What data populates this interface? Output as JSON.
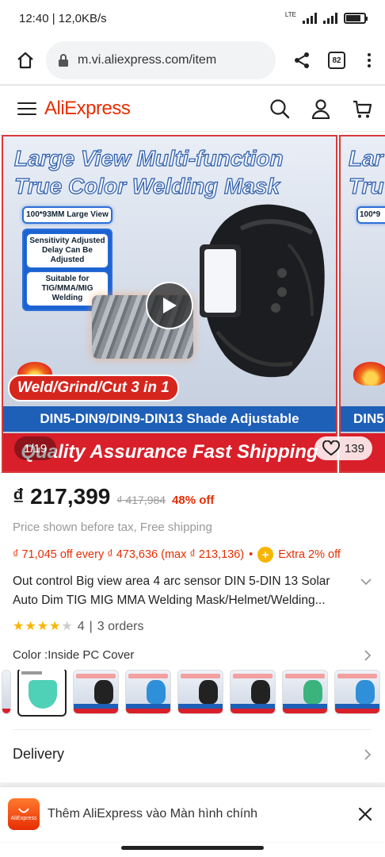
{
  "status_bar": {
    "time_speed": "12:40 | 12,0KB/s",
    "network": "LTE"
  },
  "browser": {
    "url": "m.vi.aliexpress.com/item",
    "tabs_count": "82"
  },
  "site": {
    "logo": "AliExpress"
  },
  "gallery": {
    "headline_line1": "Large View Multi-function",
    "headline_line2": "True Color Welding Mask",
    "feature_1": "100*93MM Large View",
    "feature_2": "Sensitivity Adjusted Delay Can Be Adjusted",
    "feature_3": "Suitable for TIG/MMA/MIG Welding",
    "weld_banner": "Weld/Grind/Cut 3 in 1",
    "shade_banner": "DIN5-DIN9/DIN9-DIN13 Shade Adjustable",
    "shipping_banner": "Quality Assurance Fast Shipping",
    "counter": "1/19",
    "wishlist_count": "139",
    "next_headline_1": "Lar",
    "next_headline_2": "Tru",
    "next_feature": "100*9",
    "next_shade": "DIN5"
  },
  "product": {
    "price": "₫ 217,399",
    "old_price": "₫ 417,984",
    "discount": "48% off",
    "tax_note": "Price shown before tax, Free shipping",
    "coupon": "₫ 71,045 off every ₫ 473,636 (max ₫ 213,136)",
    "coupon_sep": "•",
    "extra": "Extra 2% off",
    "title": "Out control Big view area 4 arc sensor DIN 5-DIN 13 Solar Auto Dim TIG MIG MMA Welding Mask/Helmet/Welding...",
    "rating": 4,
    "rating_text": "4",
    "rating_sep": "|",
    "orders": "3 orders",
    "color_label": "Color : ",
    "color_value": "Inside PC Cover",
    "delivery": "Delivery"
  },
  "a2hs": {
    "text": "Thêm AliExpress vào Màn hình chính",
    "icon_label": "AliExpress"
  },
  "colors": {
    "brand": "#e62e04",
    "star": "#f7b500",
    "blue_banner": "#1e5fb8",
    "red_banner": "#d91f2a"
  },
  "icons": [
    "home-icon",
    "lock-icon",
    "share-icon",
    "tabs-icon",
    "more-icon",
    "menu-icon",
    "search-icon",
    "user-icon",
    "cart-icon",
    "play-icon",
    "heart-icon",
    "coin-icon",
    "chevron-right-icon",
    "chevron-down-icon",
    "close-icon"
  ]
}
